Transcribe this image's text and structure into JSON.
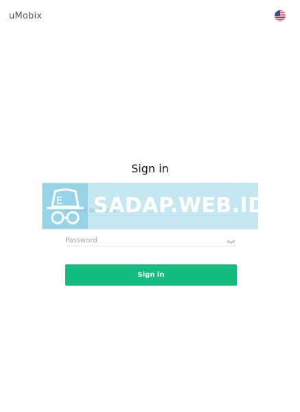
{
  "header": {
    "brand": "uMobix",
    "language_icon": "us-flag-icon"
  },
  "form": {
    "title": "Sign in",
    "email_placeholder": "E-mail address",
    "password_placeholder": "Password",
    "eye_icon": "eye-hidden-icon",
    "submit_label": "Sign in",
    "submit_color": "#12bd7e"
  },
  "watermark": {
    "text": "SADAP.WEB.ID"
  }
}
